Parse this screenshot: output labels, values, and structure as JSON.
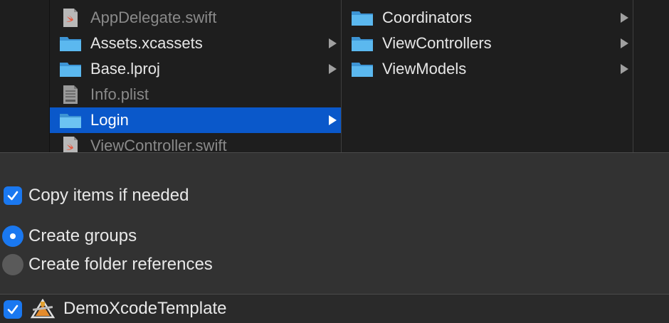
{
  "files": {
    "column1": [
      {
        "name": "AppDelegate.swift",
        "icon": "swift-file-icon",
        "dim": true,
        "has_children": false
      },
      {
        "name": "Assets.xcassets",
        "icon": "folder-icon",
        "dim": false,
        "has_children": true
      },
      {
        "name": "Base.lproj",
        "icon": "folder-icon",
        "dim": false,
        "has_children": true
      },
      {
        "name": "Info.plist",
        "icon": "plist-file-icon",
        "dim": true,
        "has_children": false
      },
      {
        "name": "Login",
        "icon": "folder-icon",
        "dim": false,
        "has_children": true,
        "selected": true
      },
      {
        "name": "ViewController.swift",
        "icon": "swift-file-icon",
        "dim": true,
        "has_children": false
      }
    ],
    "column2": [
      {
        "name": "Coordinators",
        "icon": "folder-icon",
        "has_children": true
      },
      {
        "name": "ViewControllers",
        "icon": "folder-icon",
        "has_children": true
      },
      {
        "name": "ViewModels",
        "icon": "folder-icon",
        "has_children": true
      }
    ]
  },
  "options": {
    "copy_items": {
      "label": "Copy items if needed",
      "checked": true
    },
    "create_groups": {
      "label": "Create groups",
      "selected": true
    },
    "create_folder_refs": {
      "label": "Create folder references",
      "selected": false
    }
  },
  "targets": [
    {
      "name": "DemoXcodeTemplate",
      "checked": true,
      "icon": "xcode-app-icon"
    }
  ],
  "colors": {
    "accent": "#1a78f0",
    "selection": "#0a58ca",
    "folder": "#5bb8ef",
    "background": "#323232"
  }
}
